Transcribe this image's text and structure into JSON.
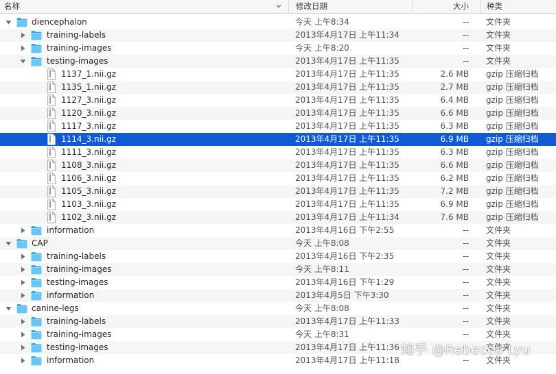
{
  "header": {
    "name": "名称",
    "date": "修改日期",
    "size": "大小",
    "kind": "种类"
  },
  "rows": [
    {
      "level": 0,
      "type": "folder",
      "open": true,
      "name": "diencephalon",
      "date": "今天 上午8:34",
      "size": "--",
      "kind": "文件夹"
    },
    {
      "level": 1,
      "type": "folder",
      "open": false,
      "name": "training-labels",
      "date": "2013年4月17日 上午11:34",
      "size": "--",
      "kind": "文件夹"
    },
    {
      "level": 1,
      "type": "folder",
      "open": false,
      "name": "training-images",
      "date": "今天 上午8:20",
      "size": "--",
      "kind": "文件夹"
    },
    {
      "level": 1,
      "type": "folder",
      "open": true,
      "name": "testing-images",
      "date": "2013年4月17日 上午11:35",
      "size": "--",
      "kind": "文件夹"
    },
    {
      "level": 2,
      "type": "file",
      "name": "1137_1.nii.gz",
      "date": "2013年4月17日 上午11:35",
      "size": "2.6 MB",
      "kind": "gzip 压缩归档"
    },
    {
      "level": 2,
      "type": "file",
      "name": "1135_1.nii.gz",
      "date": "2013年4月17日 上午11:35",
      "size": "2.7 MB",
      "kind": "gzip 压缩归档"
    },
    {
      "level": 2,
      "type": "file",
      "name": "1127_3.nii.gz",
      "date": "2013年4月17日 上午11:35",
      "size": "6.4 MB",
      "kind": "gzip 压缩归档"
    },
    {
      "level": 2,
      "type": "file",
      "name": "1120_3.nii.gz",
      "date": "2013年4月17日 上午11:35",
      "size": "6.6 MB",
      "kind": "gzip 压缩归档"
    },
    {
      "level": 2,
      "type": "file",
      "name": "1117_3.nii.gz",
      "date": "2013年4月17日 上午11:35",
      "size": "6.3 MB",
      "kind": "gzip 压缩归档"
    },
    {
      "level": 2,
      "type": "file",
      "name": "1114_3.nii.gz",
      "date": "2013年4月17日 上午11:35",
      "size": "6.9 MB",
      "kind": "gzip 压缩归档",
      "selected": true
    },
    {
      "level": 2,
      "type": "file",
      "name": "1111_3.nii.gz",
      "date": "2013年4月17日 上午11:35",
      "size": "6.3 MB",
      "kind": "gzip 压缩归档"
    },
    {
      "level": 2,
      "type": "file",
      "name": "1108_3.nii.gz",
      "date": "2013年4月17日 上午11:35",
      "size": "6.6 MB",
      "kind": "gzip 压缩归档"
    },
    {
      "level": 2,
      "type": "file",
      "name": "1106_3.nii.gz",
      "date": "2013年4月17日 上午11:35",
      "size": "6.2 MB",
      "kind": "gzip 压缩归档"
    },
    {
      "level": 2,
      "type": "file",
      "name": "1105_3.nii.gz",
      "date": "2013年4月17日 上午11:35",
      "size": "7.2 MB",
      "kind": "gzip 压缩归档"
    },
    {
      "level": 2,
      "type": "file",
      "name": "1103_3.nii.gz",
      "date": "2013年4月17日 上午11:35",
      "size": "6.9 MB",
      "kind": "gzip 压缩归档"
    },
    {
      "level": 2,
      "type": "file",
      "name": "1102_3.nii.gz",
      "date": "2013年4月17日 上午11:34",
      "size": "7.6 MB",
      "kind": "gzip 压缩归档"
    },
    {
      "level": 1,
      "type": "folder",
      "open": false,
      "name": "information",
      "date": "2013年4月16日 下午2:55",
      "size": "--",
      "kind": "文件夹"
    },
    {
      "level": 0,
      "type": "folder",
      "open": true,
      "name": "CAP",
      "date": "今天 上午8:08",
      "size": "--",
      "kind": "文件夹"
    },
    {
      "level": 1,
      "type": "folder",
      "open": false,
      "name": "training-labels",
      "date": "2013年4月16日 下午2:35",
      "size": "--",
      "kind": "文件夹"
    },
    {
      "level": 1,
      "type": "folder",
      "open": false,
      "name": "training-images",
      "date": "今天 上午8:11",
      "size": "--",
      "kind": "文件夹"
    },
    {
      "level": 1,
      "type": "folder",
      "open": false,
      "name": "testing-images",
      "date": "2013年4月16日 下午1:29",
      "size": "--",
      "kind": "文件夹"
    },
    {
      "level": 1,
      "type": "folder",
      "open": false,
      "name": "information",
      "date": "2013年4月5日 下午3:30",
      "size": "--",
      "kind": "文件夹"
    },
    {
      "level": 0,
      "type": "folder",
      "open": true,
      "name": "canine-legs",
      "date": "今天 上午8:08",
      "size": "--",
      "kind": "文件夹"
    },
    {
      "level": 1,
      "type": "folder",
      "open": false,
      "name": "training-labels",
      "date": "2013年4月17日 上午11:33",
      "size": "--",
      "kind": "文件夹"
    },
    {
      "level": 1,
      "type": "folder",
      "open": false,
      "name": "training-images",
      "date": "今天 上午8:31",
      "size": "--",
      "kind": "文件夹"
    },
    {
      "level": 1,
      "type": "folder",
      "open": false,
      "name": "testing-images",
      "date": "2013年4月17日 上午11:36",
      "size": "--",
      "kind": "文件夹"
    },
    {
      "level": 1,
      "type": "folder",
      "open": false,
      "name": "information",
      "date": "2013年4月17日 上午11:18",
      "size": "--",
      "kind": "文件夹"
    }
  ],
  "watermark": "知乎 @Rebecca Lyu",
  "colors": {
    "selection": "#0f5bd6",
    "folder": "#5ec2f5",
    "alt_row": "#f4f5f5"
  }
}
